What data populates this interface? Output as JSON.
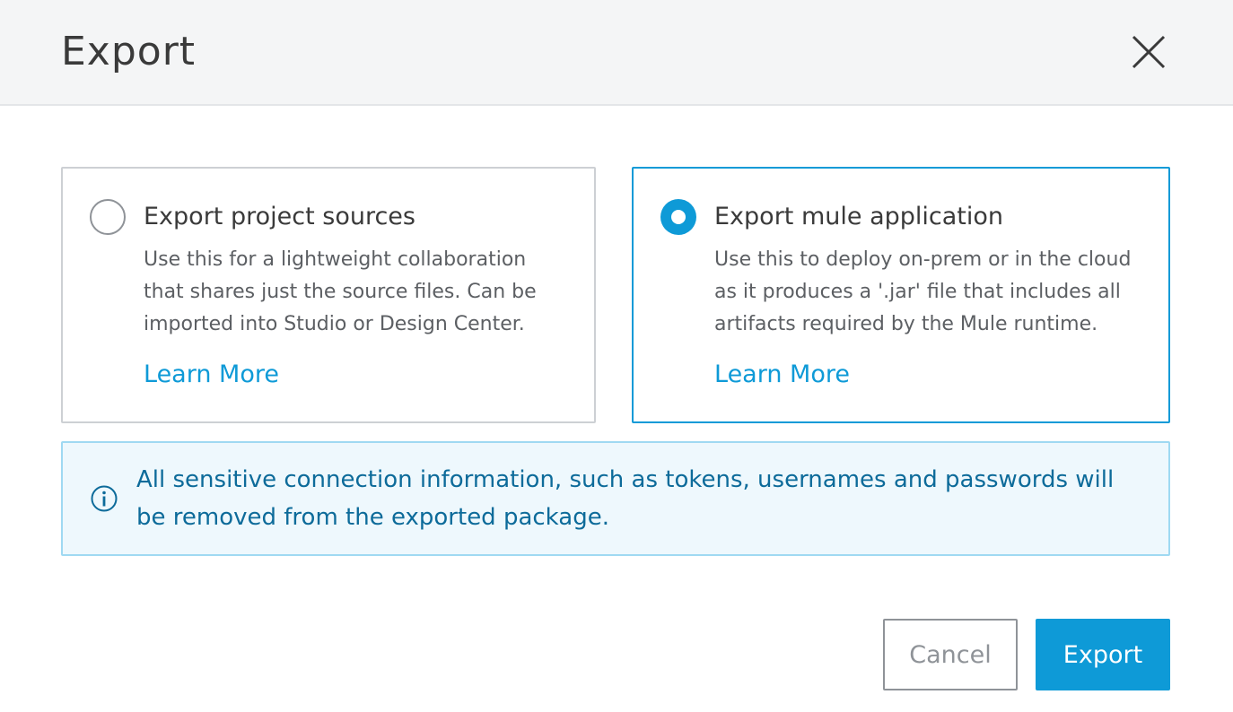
{
  "dialog": {
    "title": "Export",
    "close_icon": "close-icon"
  },
  "options": [
    {
      "title": "Export project sources",
      "description": "Use this for a lightweight collaboration that shares just the source files. Can be imported into Studio or Design Center.",
      "link": "Learn More",
      "selected": false
    },
    {
      "title": "Export mule application",
      "description": "Use this to deploy on-prem or in the cloud as it produces a '.jar' file that includes all artifacts required by the Mule runtime.",
      "link": "Learn More",
      "selected": true
    }
  ],
  "info": {
    "icon": "info-icon",
    "text": "All sensitive connection information, such as tokens, usernames and passwords will be removed from the exported package."
  },
  "footer": {
    "cancel_label": "Cancel",
    "export_label": "Export"
  },
  "colors": {
    "accent": "#0e9ad7",
    "info_background": "#eef8fd",
    "info_text": "#0d6b9a",
    "header_background": "#f4f5f6"
  }
}
